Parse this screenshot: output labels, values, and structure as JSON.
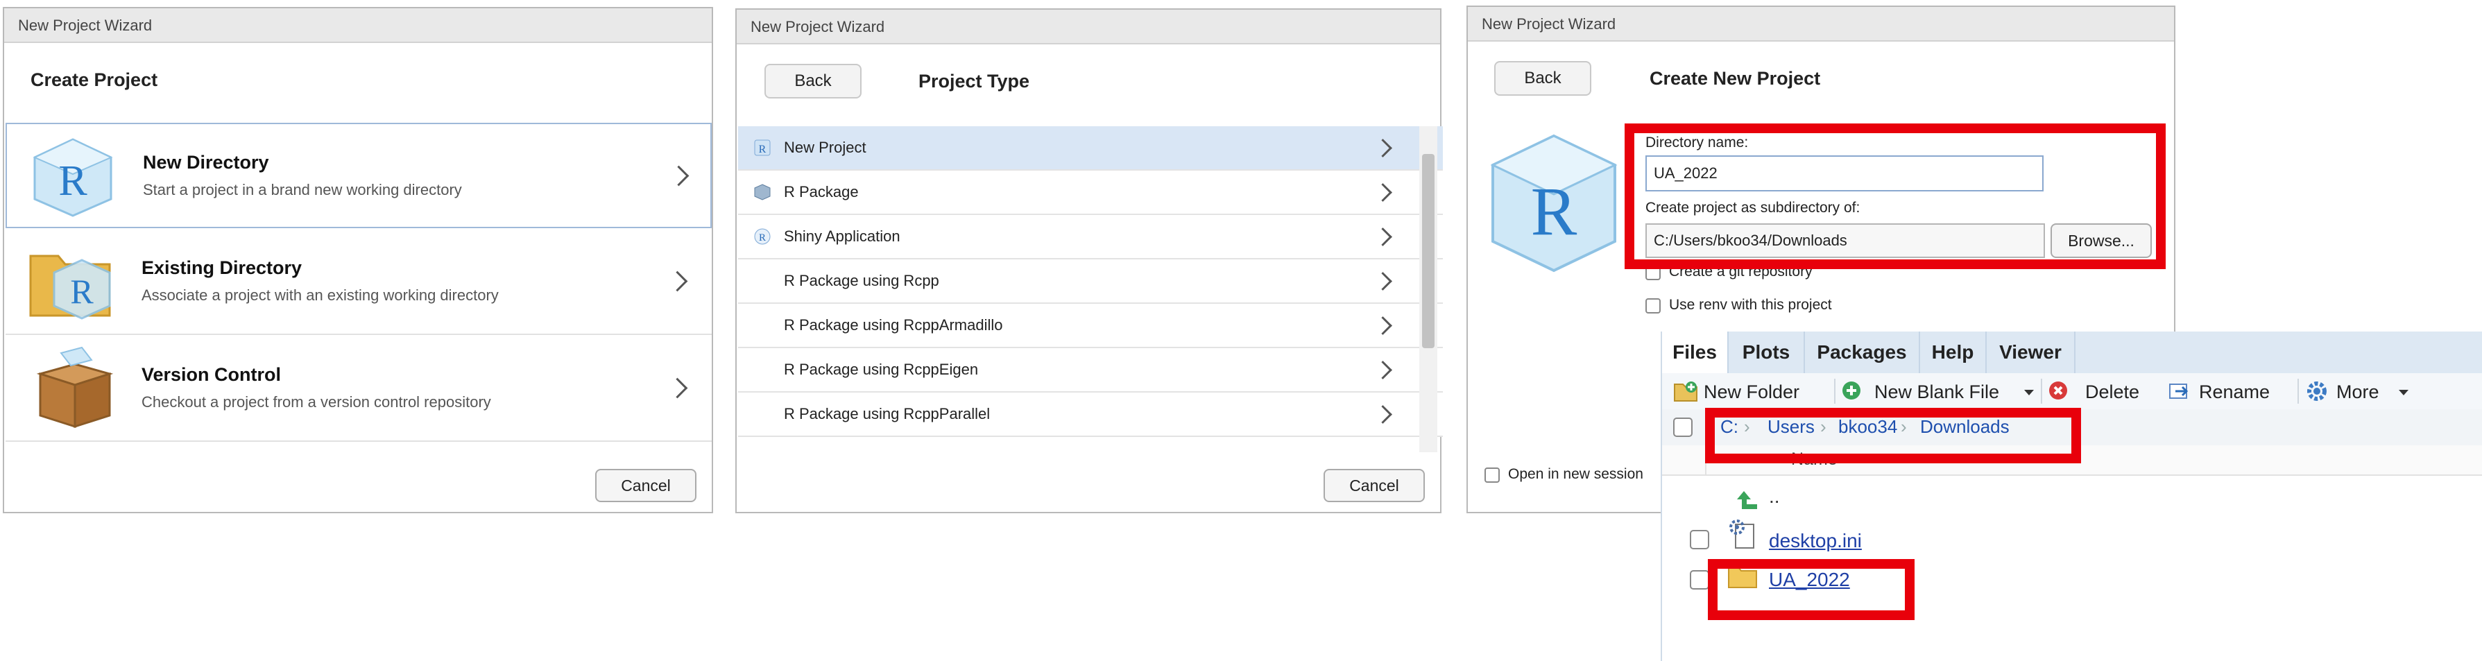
{
  "dialog1": {
    "window_title": "New Project Wizard",
    "heading": "Create Project",
    "rows": [
      {
        "title": "New Directory",
        "desc": "Start a project in a brand new working directory",
        "icon": "r-cube-icon"
      },
      {
        "title": "Existing Directory",
        "desc": "Associate a project with an existing working directory",
        "icon": "folder-r-icon"
      },
      {
        "title": "Version Control",
        "desc": "Checkout a project from a version control repository",
        "icon": "package-box-icon"
      }
    ],
    "cancel": "Cancel"
  },
  "dialog2": {
    "window_title": "New Project Wizard",
    "back": "Back",
    "heading": "Project Type",
    "items": [
      {
        "label": "New Project",
        "icon": "r-project-icon"
      },
      {
        "label": "R Package",
        "icon": "package-icon"
      },
      {
        "label": "Shiny Application",
        "icon": "shiny-r-icon"
      },
      {
        "label": "R Package using Rcpp",
        "icon": ""
      },
      {
        "label": "R Package using RcppArmadillo",
        "icon": ""
      },
      {
        "label": "R Package using RcppEigen",
        "icon": ""
      },
      {
        "label": "R Package using RcppParallel",
        "icon": ""
      }
    ],
    "cancel": "Cancel"
  },
  "dialog3": {
    "window_title": "New Project Wizard",
    "back": "Back",
    "heading": "Create New Project",
    "dir_label": "Directory name:",
    "dir_value": "UA_2022",
    "sub_label": "Create project as subdirectory of:",
    "sub_value": "C:/Users/bkoo34/Downloads",
    "browse": "Browse...",
    "git_label": "Create a git repository",
    "renv_label": "Use renv with this project",
    "open_label": "Open in new session"
  },
  "files_pane": {
    "tabs": [
      "Files",
      "Plots",
      "Packages",
      "Help",
      "Viewer"
    ],
    "toolbar": {
      "new_folder": "New Folder",
      "new_blank_file": "New Blank File",
      "delete": "Delete",
      "rename": "Rename",
      "more": "More"
    },
    "breadcrumb": [
      "C:",
      "Users",
      "bkoo34",
      "Downloads"
    ],
    "column_name": "Name",
    "files": [
      {
        "name": "..",
        "icon": "up-arrow-icon"
      },
      {
        "name": "desktop.ini",
        "icon": "settings-file-icon"
      },
      {
        "name": "UA_2022",
        "icon": "folder-icon"
      }
    ]
  },
  "colors": {
    "highlight": "#e8000b",
    "accent": "#1e3fa6",
    "selected_row": "#d9e6f5"
  }
}
